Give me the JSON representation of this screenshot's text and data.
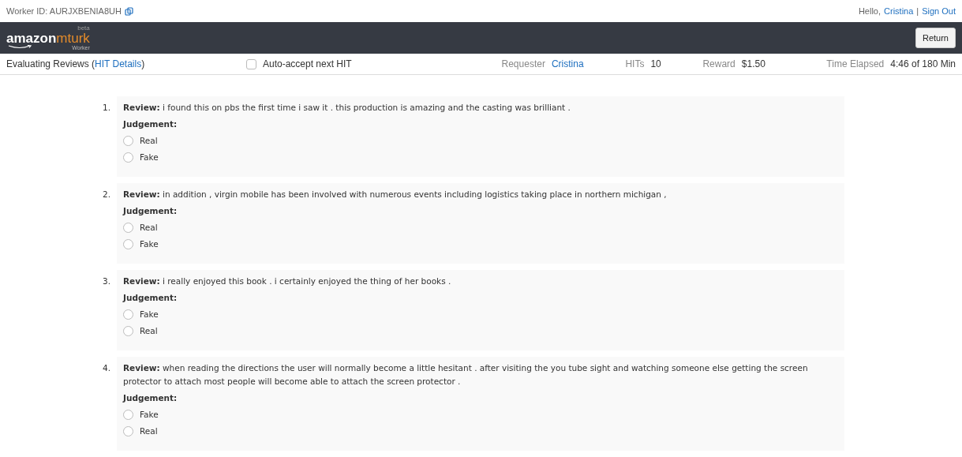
{
  "topbar": {
    "worker_id": "Worker ID: AURJXBENIA8UH",
    "greeting": "Hello,",
    "user": "Cristina",
    "separator": "|",
    "sign_out": "Sign Out"
  },
  "header": {
    "logo_main": "amazon",
    "logo_accent": "mturk",
    "logo_tag": "beta",
    "logo_sub": "Worker",
    "return_button": "Return"
  },
  "hit_bar": {
    "title": "Evaluating Reviews (",
    "details_link": "HIT Details",
    "title_end": ")",
    "auto_accept": {
      "label": "Auto-accept next HIT",
      "checked": false
    },
    "stats": [
      {
        "label": "Requester",
        "value": "Cristina",
        "kind": "link"
      },
      {
        "label": "HITs",
        "value": "10",
        "kind": "text"
      },
      {
        "label": "Reward",
        "value": "$1.50",
        "kind": "text"
      },
      {
        "label": "Time Elapsed",
        "value": "4:46 of 180 Min",
        "kind": "text"
      }
    ]
  },
  "questions": [
    {
      "number": "1.",
      "review": "**Review:** i found this on pbs the first time i saw it . this production is amazing and the casting was brilliant .",
      "judgement": "Judgement:",
      "options": [
        {
          "label": "Real",
          "selected": false
        },
        {
          "label": "Fake",
          "selected": false
        }
      ]
    },
    {
      "number": "2.",
      "review": "**Review:** in addition , virgin mobile has been involved with numerous events including logistics taking place in northern michigan ,",
      "judgement": "Judgement:",
      "options": [
        {
          "label": "Real",
          "selected": false
        },
        {
          "label": "Fake",
          "selected": false
        }
      ]
    },
    {
      "number": "3.",
      "review": "**Review:** i really enjoyed this book . i certainly enjoyed the thing of her books .",
      "judgement": "Judgement:",
      "options": [
        {
          "label": "Fake",
          "selected": false
        },
        {
          "label": "Real",
          "selected": false
        }
      ]
    },
    {
      "number": "4.",
      "review": "**Review:** when reading the directions the user will normally become a little hesitant . after visiting the you tube sight and watching someone else getting the screen protector to attach most people will become able to attach the screen protector .",
      "judgement": "Judgement:",
      "options": [
        {
          "label": "Fake",
          "selected": false
        },
        {
          "label": "Real",
          "selected": false
        }
      ]
    }
  ]
}
